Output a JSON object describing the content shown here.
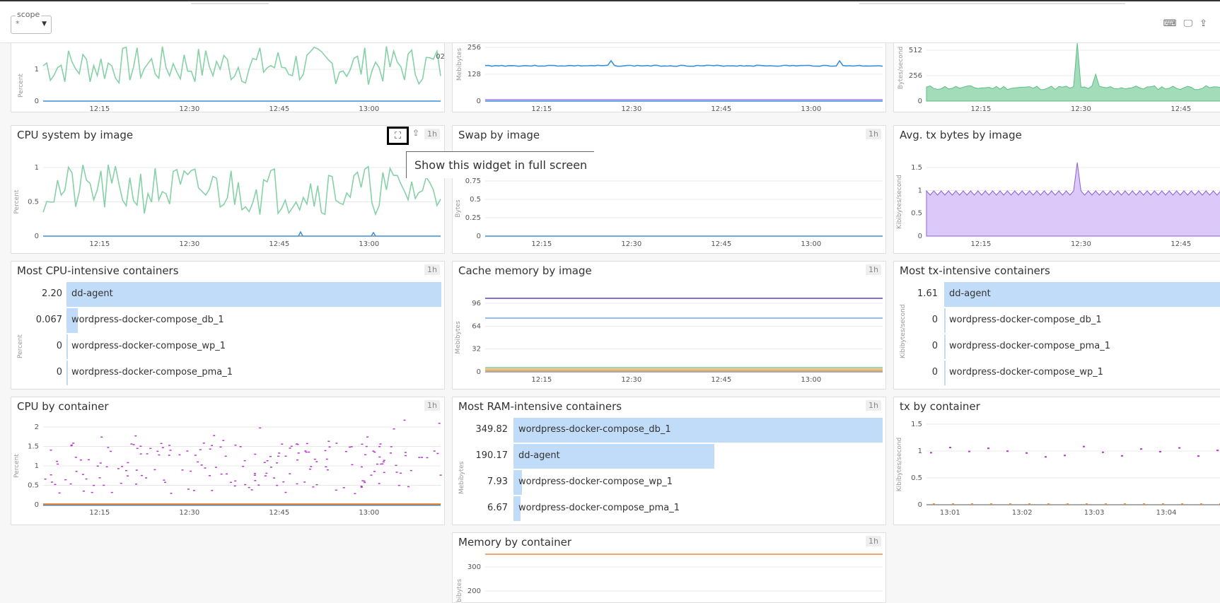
{
  "topbar": {
    "scope_legend": "scope",
    "scope_value": "*",
    "icons": [
      "keyboard-icon",
      "monitor-icon",
      "share-icon"
    ]
  },
  "tooltip": {
    "text": "Show this widget in full screen"
  },
  "widgets": {
    "cpu_top": {
      "ylabel": "Percent",
      "yticks": [
        "1",
        "0"
      ],
      "xticks": [
        "12:15",
        "12:30",
        "12:45",
        "13:00"
      ],
      "edge_label": "02"
    },
    "ram_top": {
      "ylabel": "Mebibytes",
      "yticks": [
        "256",
        "128",
        "0"
      ],
      "xticks": [
        "12:15",
        "12:30",
        "12:45",
        "13:00"
      ]
    },
    "rx_top": {
      "ylabel": "Bytes/second",
      "yticks": [
        "512",
        "256",
        "0"
      ],
      "xticks": [
        "12:15",
        "12:30",
        "12:45"
      ]
    },
    "cpu_system": {
      "title": "CPU system by image",
      "badge": "1h",
      "ylabel": "Percent",
      "yticks": [
        "1",
        "0.5",
        "0"
      ],
      "xticks": [
        "12:15",
        "12:30",
        "12:45",
        "13:00"
      ]
    },
    "swap": {
      "title": "Swap by image",
      "badge": "1h",
      "ylabel": "Bytes",
      "yticks": [
        "0.75",
        "0.5",
        "0.25",
        "0"
      ],
      "xticks": [
        "12:15",
        "12:30",
        "12:45",
        "13:00"
      ]
    },
    "avg_tx": {
      "title": "Avg. tx bytes by image",
      "ylabel": "Kibibytes/second",
      "yticks": [
        "1.5",
        "1",
        "0.5",
        "0"
      ],
      "xticks": [
        "12:15",
        "12:30",
        "12:45"
      ]
    },
    "most_cpu": {
      "title": "Most CPU-intensive containers",
      "badge": "1h",
      "ylabel": "Percent",
      "rows": [
        {
          "value": "2.20",
          "name": "dd-agent",
          "fraction": 1.0
        },
        {
          "value": "0.067",
          "name": "wordpress-docker-compose_db_1",
          "fraction": 0.03
        },
        {
          "value": "0",
          "name": "wordpress-docker-compose_wp_1",
          "fraction": 0
        },
        {
          "value": "0",
          "name": "wordpress-docker-compose_pma_1",
          "fraction": 0
        }
      ]
    },
    "cache": {
      "title": "Cache memory by image",
      "badge": "1h",
      "ylabel": "Mebibytes",
      "yticks": [
        "96",
        "64",
        "32",
        "0"
      ],
      "xticks": [
        "12:15",
        "12:30",
        "12:45",
        "13:00"
      ]
    },
    "most_tx": {
      "title": "Most tx-intensive containers",
      "ylabel": "Kibibytes/second",
      "rows": [
        {
          "value": "1.61",
          "name": "dd-agent",
          "fraction": 1.0
        },
        {
          "value": "0",
          "name": "wordpress-docker-compose_db_1",
          "fraction": 0
        },
        {
          "value": "0",
          "name": "wordpress-docker-compose_pma_1",
          "fraction": 0
        },
        {
          "value": "0",
          "name": "wordpress-docker-compose_wp_1",
          "fraction": 0
        }
      ]
    },
    "cpu_container": {
      "title": "CPU by container",
      "badge": "1h",
      "ylabel": "Percent",
      "yticks": [
        "2",
        "1.5",
        "1",
        "0.5",
        "0"
      ],
      "xticks": [
        "12:15",
        "12:30",
        "12:45",
        "13:00"
      ]
    },
    "most_ram": {
      "title": "Most RAM-intensive containers",
      "badge": "1h",
      "ylabel": "Mebibytes",
      "rows": [
        {
          "value": "349.82",
          "name": "wordpress-docker-compose_db_1",
          "fraction": 1.0
        },
        {
          "value": "190.17",
          "name": "dd-agent",
          "fraction": 0.544
        },
        {
          "value": "7.93",
          "name": "wordpress-docker-compose_wp_1",
          "fraction": 0.023
        },
        {
          "value": "6.67",
          "name": "wordpress-docker-compose_pma_1",
          "fraction": 0.019
        }
      ]
    },
    "tx_container": {
      "title": "tx by container",
      "ylabel": "Kibibytes/second",
      "yticks": [
        "1.5",
        "1",
        "0.5",
        "0"
      ],
      "xticks": [
        "13:01",
        "13:02",
        "13:03",
        "13:04"
      ]
    },
    "memory_container": {
      "title": "Memory by container",
      "badge": "1h",
      "ylabel": "Mebibytes",
      "yticks": [
        "300",
        "200"
      ]
    }
  },
  "colors": {
    "green": "#87d1a7",
    "blue": "#3b8fd9",
    "purple": "#a77fe6",
    "bar": "#c1dcf8",
    "magenta": "#b536c9",
    "orange": "#f08a3c"
  }
}
